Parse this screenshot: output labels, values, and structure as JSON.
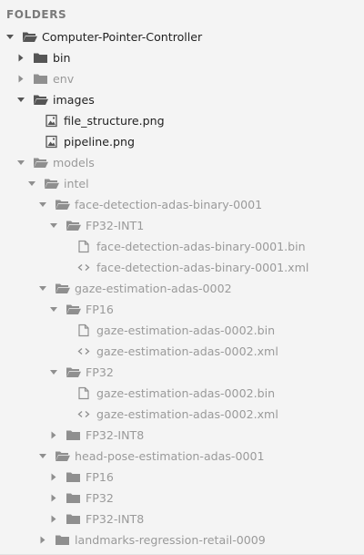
{
  "header": {
    "title": "FOLDERS"
  },
  "colors": {
    "background": "#f4f4f4",
    "text_active": "#222222",
    "text_muted": "#9a9a9a",
    "icon_active": "#555555",
    "icon_muted": "#8f8f8f"
  },
  "tree": [
    {
      "label": "Computer-Pointer-Controller",
      "depth": 0,
      "kind": "folder",
      "expanded": true,
      "dark": true,
      "icon": "folder-open-icon"
    },
    {
      "label": "bin",
      "depth": 1,
      "kind": "folder",
      "expanded": false,
      "dark": true,
      "icon": "folder-icon"
    },
    {
      "label": "env",
      "depth": 1,
      "kind": "folder",
      "expanded": false,
      "dark": false,
      "icon": "folder-icon"
    },
    {
      "label": "images",
      "depth": 1,
      "kind": "folder",
      "expanded": true,
      "dark": true,
      "icon": "folder-open-icon"
    },
    {
      "label": "file_structure.png",
      "depth": 2,
      "kind": "file",
      "dark": true,
      "icon": "image-file-icon"
    },
    {
      "label": "pipeline.png",
      "depth": 2,
      "kind": "file",
      "dark": true,
      "icon": "image-file-icon"
    },
    {
      "label": "models",
      "depth": 1,
      "kind": "folder",
      "expanded": true,
      "dark": false,
      "icon": "folder-open-icon"
    },
    {
      "label": "intel",
      "depth": 2,
      "kind": "folder",
      "expanded": true,
      "dark": false,
      "icon": "folder-open-icon"
    },
    {
      "label": "face-detection-adas-binary-0001",
      "depth": 3,
      "kind": "folder",
      "expanded": true,
      "dark": false,
      "icon": "folder-open-icon"
    },
    {
      "label": "FP32-INT1",
      "depth": 4,
      "kind": "folder",
      "expanded": true,
      "dark": false,
      "icon": "folder-open-icon"
    },
    {
      "label": "face-detection-adas-binary-0001.bin",
      "depth": 5,
      "kind": "file",
      "dark": false,
      "icon": "document-file-icon"
    },
    {
      "label": "face-detection-adas-binary-0001.xml",
      "depth": 5,
      "kind": "file",
      "dark": false,
      "icon": "code-file-icon"
    },
    {
      "label": "gaze-estimation-adas-0002",
      "depth": 3,
      "kind": "folder",
      "expanded": true,
      "dark": false,
      "icon": "folder-open-icon"
    },
    {
      "label": "FP16",
      "depth": 4,
      "kind": "folder",
      "expanded": true,
      "dark": false,
      "icon": "folder-open-icon"
    },
    {
      "label": "gaze-estimation-adas-0002.bin",
      "depth": 5,
      "kind": "file",
      "dark": false,
      "icon": "document-file-icon"
    },
    {
      "label": "gaze-estimation-adas-0002.xml",
      "depth": 5,
      "kind": "file",
      "dark": false,
      "icon": "code-file-icon"
    },
    {
      "label": "FP32",
      "depth": 4,
      "kind": "folder",
      "expanded": true,
      "dark": false,
      "icon": "folder-open-icon"
    },
    {
      "label": "gaze-estimation-adas-0002.bin",
      "depth": 5,
      "kind": "file",
      "dark": false,
      "icon": "document-file-icon"
    },
    {
      "label": "gaze-estimation-adas-0002.xml",
      "depth": 5,
      "kind": "file",
      "dark": false,
      "icon": "code-file-icon"
    },
    {
      "label": "FP32-INT8",
      "depth": 4,
      "kind": "folder",
      "expanded": false,
      "dark": false,
      "icon": "folder-icon"
    },
    {
      "label": "head-pose-estimation-adas-0001",
      "depth": 3,
      "kind": "folder",
      "expanded": true,
      "dark": false,
      "icon": "folder-open-icon"
    },
    {
      "label": "FP16",
      "depth": 4,
      "kind": "folder",
      "expanded": false,
      "dark": false,
      "icon": "folder-icon"
    },
    {
      "label": "FP32",
      "depth": 4,
      "kind": "folder",
      "expanded": false,
      "dark": false,
      "icon": "folder-icon"
    },
    {
      "label": "FP32-INT8",
      "depth": 4,
      "kind": "folder",
      "expanded": false,
      "dark": false,
      "icon": "folder-icon"
    },
    {
      "label": "landmarks-regression-retail-0009",
      "depth": 3,
      "kind": "folder",
      "expanded": false,
      "dark": false,
      "icon": "folder-icon"
    }
  ]
}
